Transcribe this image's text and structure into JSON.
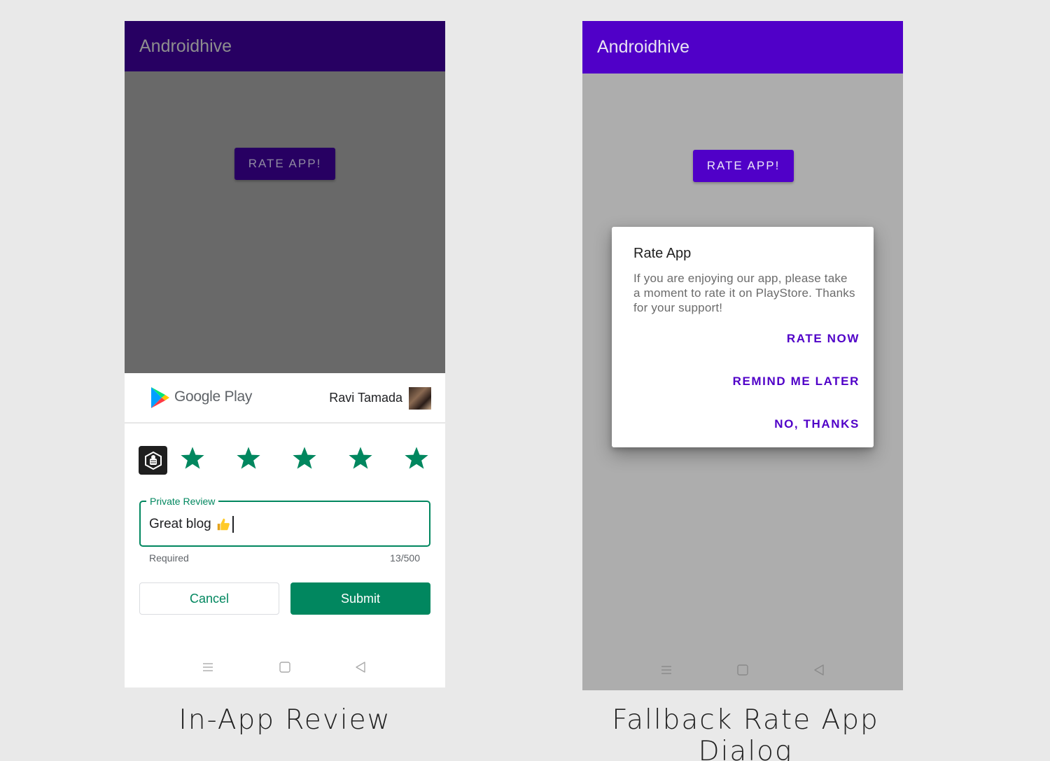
{
  "left_screen": {
    "app_title": "Androidhive",
    "rate_button": "RATE APP!",
    "play_sheet": {
      "store_name": "Google Play",
      "user_name": "Ravi Tamada",
      "rating_stars": 5,
      "review_label": "Private Review",
      "review_text": "Great blog",
      "review_emoji_icon": "thumbs-up-icon",
      "helper_text": "Required",
      "char_count": "13/500",
      "cancel_label": "Cancel",
      "submit_label": "Submit"
    },
    "caption": "In-App Review"
  },
  "right_screen": {
    "app_title": "Androidhive",
    "rate_button": "RATE APP!",
    "dialog": {
      "title": "Rate App",
      "message": "If you are enjoying our app, please take a moment to rate it on PlayStore. Thanks for your support!",
      "buttons": [
        "RATE NOW",
        "REMIND ME LATER",
        "NO, THANKS"
      ]
    },
    "caption": "Fallback Rate App Dialog"
  },
  "nav_icons": [
    "menu-icon",
    "home-square-icon",
    "back-triangle-icon"
  ],
  "colors": {
    "play_green": "#01875f",
    "accent_purple": "#5000c8",
    "dim_purple": "#270062",
    "star_color": "#01875f"
  }
}
